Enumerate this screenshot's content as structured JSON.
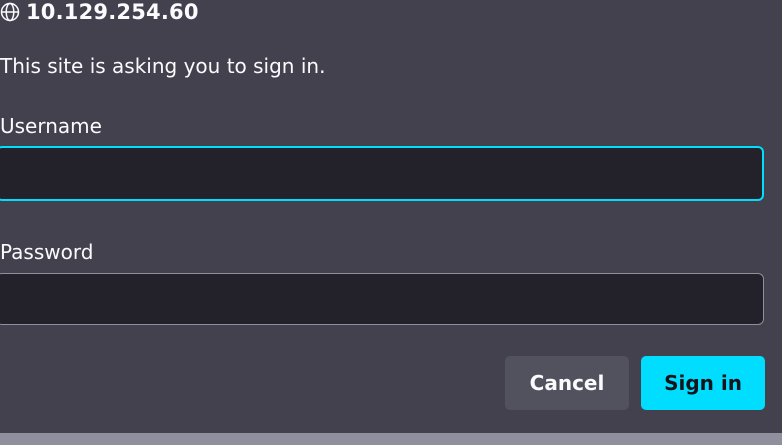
{
  "dialog": {
    "site": "10.129.254.60",
    "message": "This site is asking you to sign in.",
    "username_label": "Username",
    "username_value": "",
    "password_label": "Password",
    "password_value": "",
    "cancel_label": "Cancel",
    "signin_label": "Sign in",
    "icon": "globe-icon"
  },
  "colors": {
    "background": "#42414d",
    "input_background": "#23222b",
    "accent": "#00ddff",
    "secondary_button": "#52525e",
    "text": "#fbfbfe"
  }
}
